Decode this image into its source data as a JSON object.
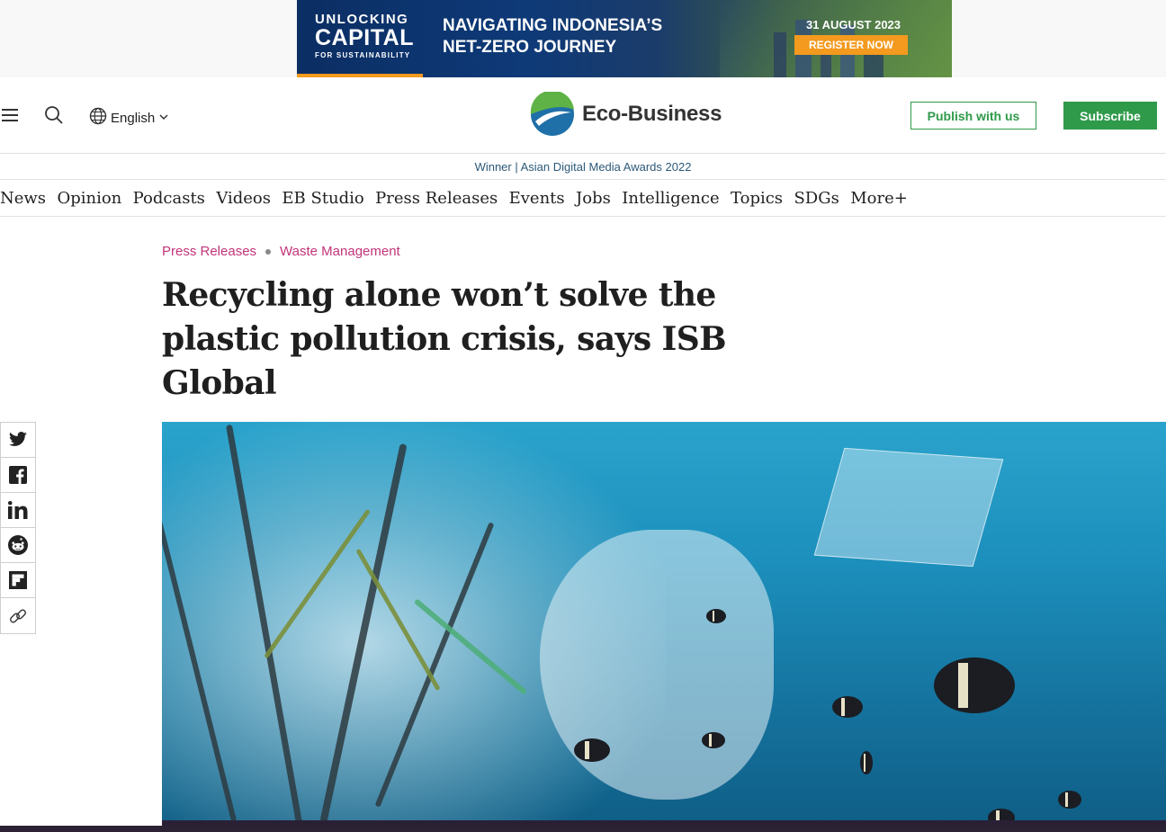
{
  "ad": {
    "brand_line1": "UNLOCKING",
    "brand_line2": "CAPITAL",
    "brand_line3": "FOR SUSTAINABILITY",
    "headline_line1": "NAVIGATING INDONESIA’S",
    "headline_line2": "NET-ZERO JOURNEY",
    "date": "31 AUGUST 2023",
    "cta": "REGISTER NOW"
  },
  "header": {
    "language": "English",
    "logo_text": "Eco-Business",
    "publish_label": "Publish with us",
    "subscribe_label": "Subscribe"
  },
  "award": "Winner | Asian Digital Media Awards 2022",
  "nav": [
    "News",
    "Opinion",
    "Podcasts",
    "Videos",
    "EB Studio",
    "Press Releases",
    "Events",
    "Jobs",
    "Intelligence",
    "Topics",
    "SDGs",
    "More+"
  ],
  "article": {
    "category": "Press Releases",
    "subcategory": "Waste Management",
    "title": "Recycling alone won’t solve the plastic pollution crisis, says ISB Global"
  },
  "share": [
    "twitter-icon",
    "facebook-icon",
    "linkedin-icon",
    "reddit-icon",
    "flipboard-icon",
    "link-icon"
  ],
  "colors": {
    "accent_green": "#2f9a4a",
    "category_pink": "#c2347a",
    "ad_orange": "#f39a1f"
  }
}
